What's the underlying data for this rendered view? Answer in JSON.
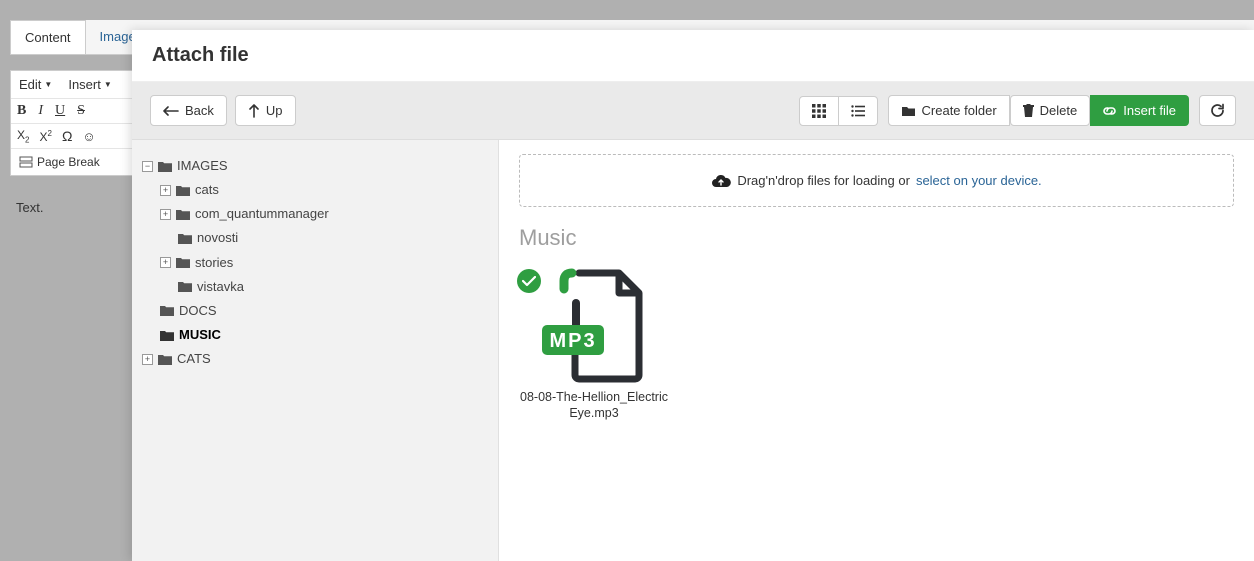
{
  "background": {
    "tabs": [
      "Content",
      "Images"
    ],
    "menus": {
      "edit": "Edit",
      "insert": "Insert"
    },
    "pagebreak": "Page Break",
    "text": "Text."
  },
  "modal": {
    "title": "Attach file",
    "toolbar": {
      "back": "Back",
      "up": "Up",
      "create_folder": "Create folder",
      "delete": "Delete",
      "insert_file": "Insert file"
    },
    "dropzone": {
      "text": "Drag'n'drop files for loading or ",
      "link": "select on your device."
    },
    "section_title": "Music"
  },
  "tree": {
    "root": "IMAGES",
    "children": [
      "cats",
      "com_quantummanager",
      "novosti",
      "stories",
      "vistavka"
    ],
    "siblings": [
      "DOCS",
      "MUSIC",
      "CATS"
    ]
  },
  "files": [
    {
      "name": "08-08-The-Hellion_Electric Eye.mp3",
      "type": "MP3"
    }
  ]
}
